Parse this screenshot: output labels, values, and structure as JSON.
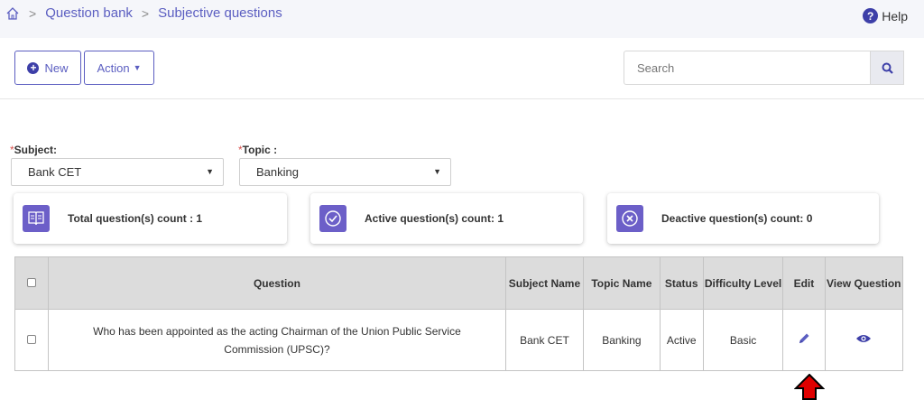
{
  "breadcrumb": {
    "items": [
      "Question bank",
      "Subjective questions"
    ]
  },
  "help": {
    "label": "Help"
  },
  "toolbar": {
    "new_label": "New",
    "action_label": "Action"
  },
  "search": {
    "placeholder": "Search"
  },
  "filters": {
    "subject": {
      "label": "Subject:",
      "value": "Bank CET"
    },
    "topic": {
      "label": "Topic :",
      "value": "Banking"
    }
  },
  "counts": {
    "total": "Total question(s) count : 1",
    "active": "Active question(s) count: 1",
    "deactive": "Deactive question(s) count: 0"
  },
  "table": {
    "headers": [
      "Question",
      "Subject Name",
      "Topic Name",
      "Status",
      "Difficulty Level",
      "Edit",
      "View Question"
    ],
    "rows": [
      {
        "question": "Who has been appointed as the acting Chairman of the Union Public Service Commission (UPSC)?",
        "subject": "Bank CET",
        "topic": "Banking",
        "status": "Active",
        "difficulty": "Basic"
      }
    ]
  },
  "colors": {
    "accent": "#5b5ec1",
    "card_icon": "#6c5fc8",
    "arrow": "#e00000"
  },
  "icons": [
    "home-icon",
    "help-icon",
    "plus-icon",
    "search-icon",
    "book-icon",
    "check-circle-icon",
    "x-circle-icon",
    "pencil-icon",
    "eye-icon",
    "up-arrow-icon"
  ]
}
